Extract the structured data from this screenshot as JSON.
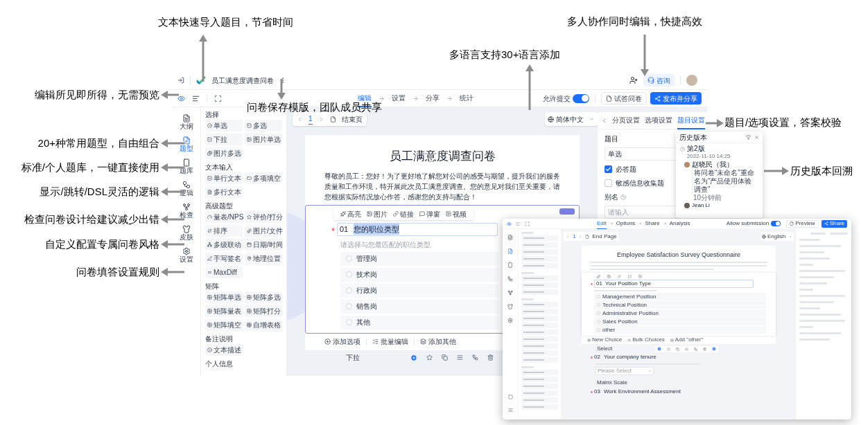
{
  "annotations": [
    "文本快速导入题目，节省时间",
    "多人协作同时编辑，快捷高效",
    "多语言支持30+语言添加",
    "问卷保存模版，团队成员共享",
    "编辑所见即所得，无需预览",
    "20+种常用题型，自由组合",
    "标准/个人题库，一键直接使用",
    "显示/跳转/DSL灵活的逻辑",
    "检查问卷设计给建议减少出错",
    "自定义配置专属问卷风格",
    "问卷填答设置规则",
    "题目/选项设置，答案校验",
    "历史版本回溯"
  ],
  "app": {
    "title": "员工满意度调查问卷",
    "consult_button": "咨询",
    "steps": [
      {
        "label": "编辑",
        "selected": true
      },
      {
        "label": "设置",
        "selected": false
      },
      {
        "label": "分享",
        "selected": false
      },
      {
        "label": "统计",
        "selected": false
      }
    ],
    "allow_submit": {
      "label": "允许提交",
      "on": true
    },
    "try_button": "试答问卷",
    "publish_button": "发布并分享",
    "rail": [
      {
        "label": "大纲",
        "selected": false
      },
      {
        "label": "题型",
        "selected": true
      },
      {
        "label": "题库",
        "selected": false
      },
      {
        "label": "逻辑",
        "selected": false
      },
      {
        "label": "检查",
        "selected": false
      },
      {
        "label": "皮肤",
        "selected": false
      },
      {
        "label": "设置",
        "selected": false
      }
    ],
    "type_groups": [
      {
        "title": "选择",
        "items": [
          "单选",
          "多选",
          "下拉",
          "图片单选",
          "图片多选"
        ]
      },
      {
        "title": "文本输入",
        "items": [
          "单行文本",
          "多项填空",
          "多行文本"
        ]
      },
      {
        "title": "高级题型",
        "items": [
          "量表/NPS",
          "评价/打分",
          "排序",
          "图片/文件",
          "多级联动",
          "日期/时间",
          "手写签名",
          "地理位置",
          "MaxDiff"
        ]
      },
      {
        "title": "矩阵",
        "items": [
          "矩阵单选",
          "矩阵多选",
          "矩阵量表",
          "矩阵打分",
          "矩阵填空",
          "自增表格"
        ]
      },
      {
        "title": "备注说明",
        "items": [
          "文本描述"
        ]
      },
      {
        "title": "个人信息"
      }
    ],
    "page_nav": {
      "page": "1",
      "end_page": "结束页"
    },
    "language": "简体中文",
    "survey": {
      "title": "员工满意度调查问卷",
      "description": "尊敬的员工：您好！为了更好地了解您对公司的感受与期望，提升我们的服务质量和工作环境，特开展此次员工满意度调查。您的意见对我们至关重要，请您根据实际情况放心作答，感谢您的支持与配合！",
      "toolbar": [
        "高亮",
        "图片",
        "链接",
        "弹窗",
        "视频"
      ],
      "question": {
        "required": true,
        "number": "01",
        "title": "您的职位类型",
        "hint": "请选择与您最匹配的职位类型",
        "options": [
          "管理岗",
          "技术岗",
          "行政岗",
          "销售岗",
          "其他"
        ]
      },
      "footer": [
        "添加选项",
        "批量编辑",
        "添加其他"
      ],
      "next_tag": "下拉"
    },
    "settings": {
      "tabs": [
        {
          "label": "分页设置",
          "selected": false
        },
        {
          "label": "选项设置",
          "selected": false
        },
        {
          "label": "题目设置",
          "selected": true
        }
      ],
      "section": "题目",
      "type_value": "单选",
      "checks": [
        {
          "label": "必答题",
          "checked": true
        },
        {
          "label": "敏感信息收集题",
          "checked": false
        }
      ],
      "alias_label": "别名",
      "alias_placeholder": "请输入"
    }
  },
  "history": {
    "title": "历史版本",
    "version": "第2版",
    "time": "2022-11-10 14:25",
    "entry": {
      "user": "赵晓民（我）",
      "action": "将问卷“未命名”重命名为“产品使用体验调查”",
      "ago": "10分钟前"
    },
    "next_user": "Jean Li"
  },
  "english_app": {
    "steps": [
      {
        "label": "Edit",
        "selected": true
      },
      {
        "label": "Options",
        "selected": false
      },
      {
        "label": "Share",
        "selected": false
      },
      {
        "label": "Analysis",
        "selected": false
      }
    ],
    "allow_submit": {
      "label": "Allow submission",
      "on": true
    },
    "preview_button": "Preview",
    "share_button": "Share",
    "rail": [
      {
        "selected": false
      },
      {
        "selected": true
      },
      {
        "selected": false
      },
      {
        "selected": false
      },
      {
        "selected": false
      },
      {
        "selected": false
      },
      {
        "selected": false
      }
    ],
    "page_nav": {
      "page": "1",
      "end_page": "End Page"
    },
    "language": "English",
    "survey": {
      "title": "Employee Satisfaction Survey Questionnaire",
      "question": {
        "required": true,
        "number": "01",
        "title": "Your Position Type",
        "options": [
          "Management Position",
          "Technical Position",
          "Administrative Position",
          "Sales Position",
          "other"
        ]
      },
      "footer": [
        "New Choice",
        "Bulk Choices",
        "Add \"other\""
      ],
      "next_tag": "Select",
      "question2": {
        "required": true,
        "number": "02",
        "title": "Your company tenure",
        "select_placeholder": "Please Select"
      },
      "next_tag2": "Matrix Scale",
      "question3": {
        "required": true,
        "number": "03",
        "title": "Work Environment Assessment"
      }
    }
  }
}
